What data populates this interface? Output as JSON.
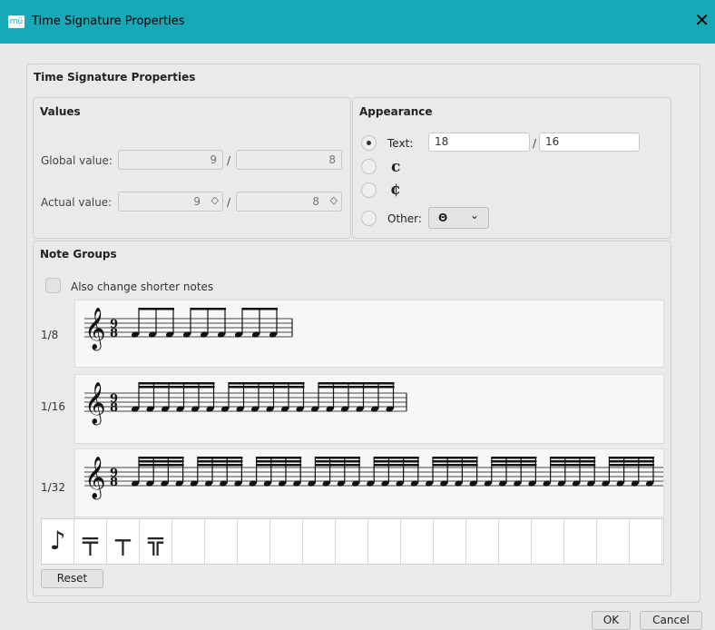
{
  "window": {
    "app_icon": "mü",
    "title": "Time Signature Properties",
    "close_glyph": "✕"
  },
  "dialog": {
    "section_title": "Time Signature Properties"
  },
  "values": {
    "heading": "Values",
    "global_label": "Global value:",
    "global_numerator": "9",
    "global_denominator": "8",
    "actual_label": "Actual value:",
    "actual_numerator": "9",
    "actual_denominator": "8",
    "separator": "/",
    "spin_glyph": "◇"
  },
  "appearance": {
    "heading": "Appearance",
    "text_label": "Text:",
    "text_numerator": "18",
    "text_denominator": "16",
    "separator": "/",
    "common_time_glyph": "c",
    "cut_time_glyph": "¢",
    "other_label": "Other:",
    "other_selected": "Θ",
    "dropdown_arrow": "⌄",
    "selected_option": "text"
  },
  "note_groups": {
    "heading": "Note Groups",
    "also_change_shorter": "Also change shorter notes",
    "time_sig_top": "9",
    "time_sig_bottom": "8",
    "rows": [
      {
        "label": "1/8",
        "beams": 1,
        "groups": [
          3,
          3,
          3
        ]
      },
      {
        "label": "1/16",
        "beams": 2,
        "groups": [
          6,
          6,
          6
        ]
      },
      {
        "label": "1/32",
        "beams": 3,
        "groups": [
          4,
          4,
          4,
          4,
          4,
          4,
          4,
          4,
          4
        ]
      }
    ],
    "palette_icons": [
      "eighth-note-icon",
      "beam-start-icon",
      "beam-middle-icon",
      "beam-32nd-icon"
    ],
    "palette_cell_count": 19,
    "reset_label": "Reset"
  },
  "footer": {
    "ok_label": "OK",
    "cancel_label": "Cancel"
  }
}
